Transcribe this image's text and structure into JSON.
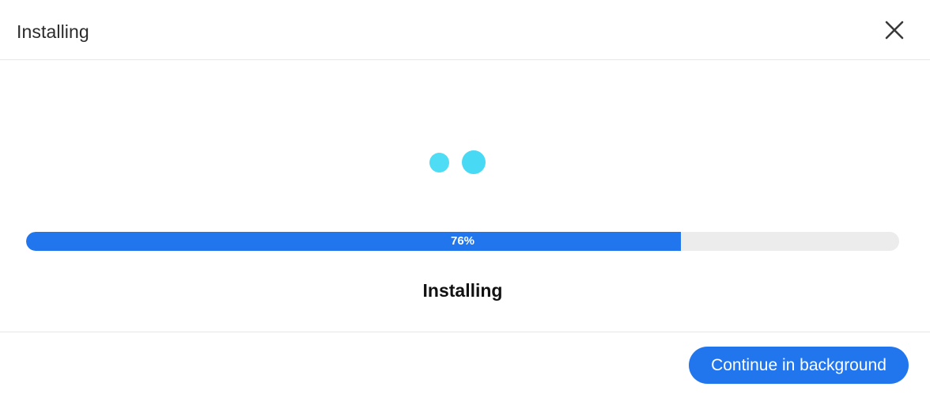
{
  "header": {
    "title": "Installing",
    "close_icon": "close-icon"
  },
  "loader": {
    "icon": "loading-dots-icon",
    "color": "#4fdcf5"
  },
  "progress": {
    "value": 0.75,
    "label": "76%",
    "fill_color": "#2276ed",
    "track_color": "#ececec"
  },
  "status": {
    "text": "Installing"
  },
  "footer": {
    "continue_label": "Continue in background",
    "button_color": "#2276ed"
  }
}
